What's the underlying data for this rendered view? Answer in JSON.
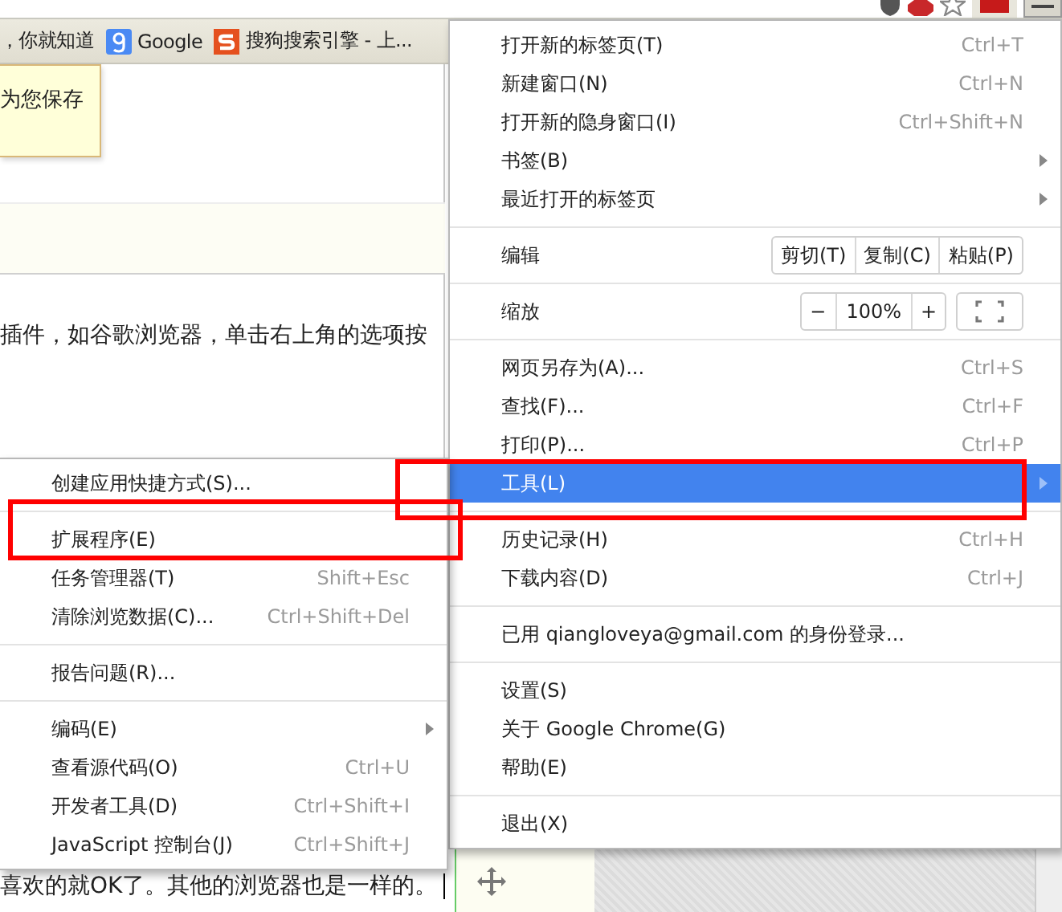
{
  "bookmarks": [
    {
      "kind": "text",
      "label": "，你就知道"
    },
    {
      "kind": "google",
      "label": "Google"
    },
    {
      "kind": "sogou",
      "label": "搜狗搜索引擎 - 上..."
    }
  ],
  "tooltip": {
    "text": "为您保存"
  },
  "article": {
    "line_1": "插件，如谷歌浏览器，单击右上角的选项按",
    "line_2": "喜欢的就OK了。其他的浏览器也是一样的。"
  },
  "main_menu": {
    "groups": [
      {
        "items": [
          {
            "kind": "item",
            "label": "打开新的标签页(T)",
            "shortcut": "Ctrl+T",
            "submenu": false,
            "selected": false
          },
          {
            "kind": "item",
            "label": "新建窗口(N)",
            "shortcut": "Ctrl+N",
            "submenu": false,
            "selected": false
          },
          {
            "kind": "item",
            "label": "打开新的隐身窗口(I)",
            "shortcut": "Ctrl+Shift+N",
            "submenu": false,
            "selected": false
          },
          {
            "kind": "item",
            "label": "书签(B)",
            "submenu": true,
            "selected": false
          },
          {
            "kind": "item",
            "label": "最近打开的标签页",
            "submenu": true,
            "selected": false
          }
        ]
      },
      {
        "items": [
          {
            "kind": "edit",
            "label": "编辑",
            "buttons": [
              "剪切(T)",
              "复制(C)",
              "粘贴(P)"
            ],
            "selected": false
          }
        ]
      },
      {
        "items": [
          {
            "kind": "zoom",
            "label": "缩放",
            "decrease": "−",
            "value": "100%",
            "increase": "+",
            "selected": false
          }
        ]
      },
      {
        "items": [
          {
            "kind": "item",
            "label": "网页另存为(A)...",
            "shortcut": "Ctrl+S",
            "submenu": false,
            "selected": false
          },
          {
            "kind": "item",
            "label": "查找(F)...",
            "shortcut": "Ctrl+F",
            "submenu": false,
            "selected": false
          },
          {
            "kind": "item",
            "label": "打印(P)...",
            "shortcut": "Ctrl+P",
            "submenu": false,
            "selected": false
          },
          {
            "kind": "item",
            "label": "工具(L)",
            "submenu": true,
            "selected": true
          }
        ]
      },
      {
        "items": [
          {
            "kind": "item",
            "label": "历史记录(H)",
            "shortcut": "Ctrl+H",
            "submenu": false,
            "selected": false
          },
          {
            "kind": "item",
            "label": "下载内容(D)",
            "shortcut": "Ctrl+J",
            "submenu": false,
            "selected": false
          }
        ]
      },
      {
        "items": [
          {
            "kind": "item",
            "label": "已用 qiangloveya@gmail.com 的身份登录...",
            "submenu": false,
            "selected": false
          }
        ]
      },
      {
        "items": [
          {
            "kind": "item",
            "label": "设置(S)",
            "submenu": false,
            "selected": false
          },
          {
            "kind": "item",
            "label": "关于 Google Chrome(G)",
            "submenu": false,
            "selected": false
          },
          {
            "kind": "item",
            "label": "帮助(E)",
            "submenu": false,
            "selected": false
          }
        ]
      },
      {
        "items": [
          {
            "kind": "item",
            "label": "退出(X)",
            "submenu": false,
            "selected": false
          }
        ]
      }
    ]
  },
  "tools_menu": {
    "groups": [
      {
        "items": [
          {
            "label": "创建应用快捷方式(S)...",
            "submenu": false,
            "selected": false
          }
        ]
      },
      {
        "items": [
          {
            "label": "扩展程序(E)",
            "submenu": false,
            "selected": false
          },
          {
            "label": "任务管理器(T)",
            "shortcut": "Shift+Esc",
            "submenu": false,
            "selected": false
          },
          {
            "label": "清除浏览数据(C)...",
            "shortcut": "Ctrl+Shift+Del",
            "submenu": false,
            "selected": false
          }
        ]
      },
      {
        "items": [
          {
            "label": "报告问题(R)...",
            "submenu": false,
            "selected": false
          }
        ]
      },
      {
        "items": [
          {
            "label": "编码(E)",
            "submenu": true,
            "selected": false
          },
          {
            "label": "查看源代码(O)",
            "shortcut": "Ctrl+U",
            "submenu": false,
            "selected": false
          },
          {
            "label": "开发者工具(D)",
            "shortcut": "Ctrl+Shift+I",
            "submenu": false,
            "selected": false
          },
          {
            "label": "JavaScript 控制台(J)",
            "shortcut": "Ctrl+Shift+J",
            "submenu": false,
            "selected": false
          }
        ]
      }
    ]
  }
}
